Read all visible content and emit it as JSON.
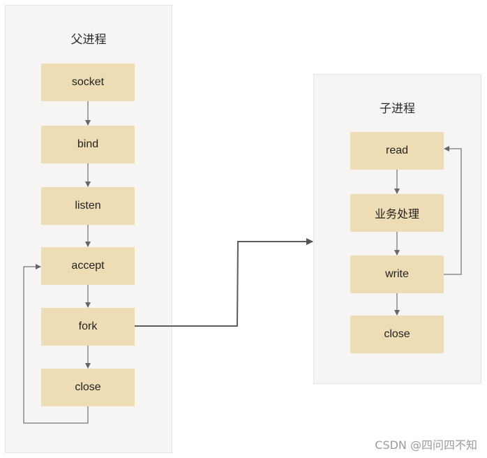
{
  "parent_process": {
    "title": "父进程",
    "steps": [
      "socket",
      "bind",
      "listen",
      "accept",
      "fork",
      "close"
    ]
  },
  "child_process": {
    "title": "子进程",
    "steps": [
      "read",
      "业务处理",
      "write",
      "close"
    ]
  },
  "colors": {
    "panel_bg": "#f6f5f4",
    "box_fill": "#eedcb4",
    "arrow": "#666666"
  },
  "watermark": "CSDN @四问四不知"
}
